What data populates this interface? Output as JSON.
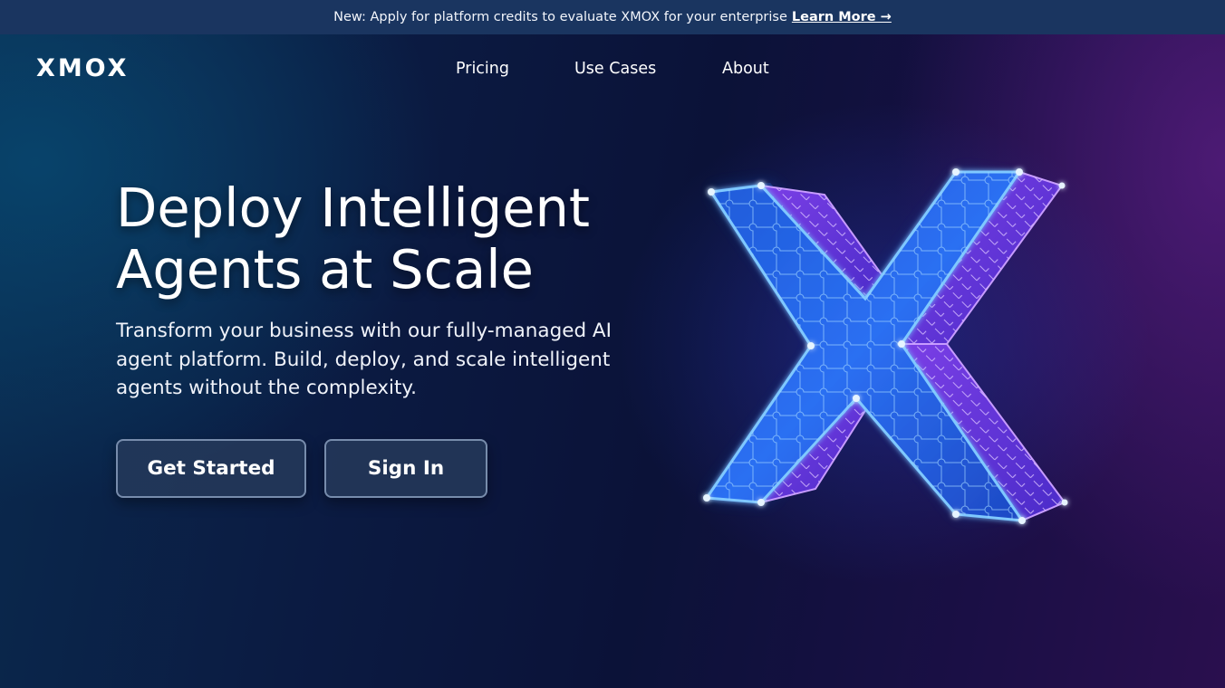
{
  "announcement": {
    "text": "New: Apply for platform credits to evaluate XMOX for your enterprise",
    "link_label": "Learn More →"
  },
  "header": {
    "logo": "XMOX",
    "nav": [
      {
        "label": "Pricing"
      },
      {
        "label": "Use Cases"
      },
      {
        "label": "About"
      }
    ]
  },
  "hero": {
    "title": "Deploy Intelligent Agents at Scale",
    "subtitle": "Transform your business with our fully-managed AI agent platform. Build, deploy, and scale intelligent agents without the complexity.",
    "primary_button": "Get Started",
    "secondary_button": "Sign In",
    "graphic_icon": "glowing-x-puzzle-icon"
  },
  "colors": {
    "announcement_bg": "#1a3560",
    "background_start": "#0a2a4e",
    "background_end": "#2a0f4e",
    "button_bg": "#263a5c",
    "button_border": "#96aac8",
    "x_glow_blue": "#3f8cff",
    "x_glow_purple": "#a855f7"
  }
}
